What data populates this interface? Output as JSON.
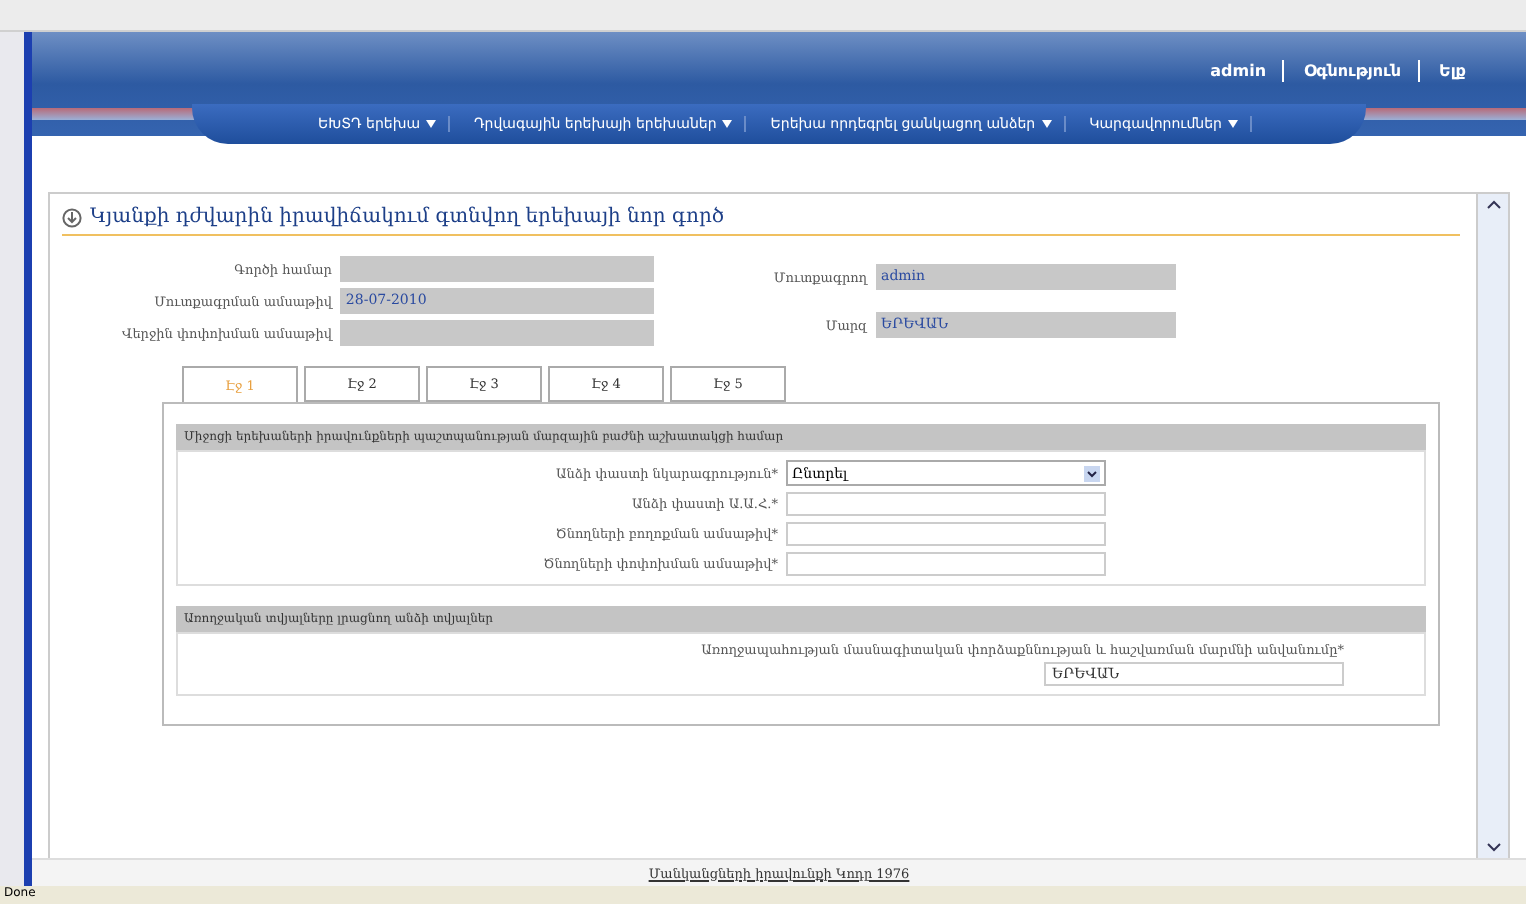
{
  "header": {
    "links": [
      "admin",
      "Օգնություն",
      "Ելք"
    ]
  },
  "nav": [
    "ԵԽՏԴ երեխա",
    "Դրվագային երեխայի երեխաներ",
    "Երեխա որդեգրել ցանկացող անձեր",
    "Կարգավորումներ"
  ],
  "form": {
    "title": "Կյանքի դժվարին իրավիճակում գտնվող երեխայի նոր գործ",
    "left_fields": [
      {
        "label": "Գործի համար"
      },
      {
        "label": "Մուտքագրման ամսաթիվ",
        "value": "28-07-2010"
      },
      {
        "label": "Վերջին փոփոխման ամսաթիվ"
      }
    ],
    "right_fields": [
      {
        "label": "Մուտքագրող",
        "value": "admin"
      },
      {
        "label": "Մարզ",
        "value": "ԵՐԵՎԱՆ"
      }
    ],
    "tabs": [
      {
        "label": "Էջ 1",
        "selected": true
      },
      {
        "label": "Էջ 2",
        "selected": false
      },
      {
        "label": "Էջ 3",
        "selected": false
      },
      {
        "label": "Էջ 4",
        "selected": false
      },
      {
        "label": "Էջ 5",
        "selected": false
      }
    ],
    "sections": [
      {
        "title": "Միջոցի երեխաների իրավունքների պաշտպանության մարզային բաժնի աշխատակցի համար",
        "rows": [
          {
            "kind": "select",
            "label": "Անձի փաստի նկարագրություն*",
            "value": "Ընտրել"
          },
          {
            "kind": "text",
            "label": "Անձի փաստի Ա.Ա.Հ.*"
          },
          {
            "kind": "text",
            "label": "Ծնողների բողոքման ամսաթիվ*"
          },
          {
            "kind": "text",
            "label": "Ծնողների փոփոխման ամսաթիվ*"
          }
        ]
      },
      {
        "title": "Առողջական տվյալները լրացնող անձի տվյալներ",
        "rows": [
          {
            "kind": "wide",
            "label": "Առողջապահության մասնագիտական փորձաքննության և հաշվառման մարմնի անվանումը*",
            "value": "ԵՐԵՎԱՆ"
          }
        ]
      }
    ]
  },
  "footer": {
    "link": "Մանկանցների իրավունքի Կոդը 1976"
  },
  "status_bar": "Done"
}
